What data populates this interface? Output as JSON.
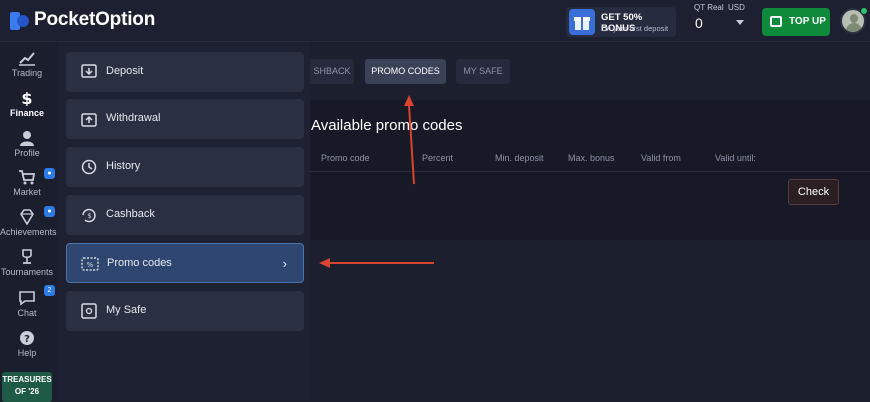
{
  "brand": {
    "name": "PocketOption"
  },
  "header": {
    "bonus_title": "GET 50% BONUS",
    "bonus_sub": "On your first deposit",
    "account_type": "QT Real",
    "currency": "USD",
    "balance": "0",
    "topup_label": "TOP UP"
  },
  "sidebar": {
    "items": [
      {
        "label": "Trading",
        "icon": "chart-icon"
      },
      {
        "label": "Finance",
        "icon": "dollar-icon",
        "active": true
      },
      {
        "label": "Profile",
        "icon": "user-icon"
      },
      {
        "label": "Market",
        "icon": "cart-icon",
        "badge": ""
      },
      {
        "label": "Achievements",
        "icon": "diamond-icon",
        "badge": ""
      },
      {
        "label": "Tournaments",
        "icon": "trophy-icon"
      },
      {
        "label": "Chat",
        "icon": "chat-icon",
        "badge": "2"
      },
      {
        "label": "Help",
        "icon": "help-icon"
      }
    ],
    "promo_tile": {
      "line1": "TREASURES",
      "line2": "OF '26"
    }
  },
  "finance_menu": {
    "items": [
      {
        "label": "Deposit",
        "icon": "deposit-icon"
      },
      {
        "label": "Withdrawal",
        "icon": "withdrawal-icon"
      },
      {
        "label": "History",
        "icon": "history-icon"
      },
      {
        "label": "Cashback",
        "icon": "cashback-icon"
      },
      {
        "label": "Promo codes",
        "icon": "promo-code-icon",
        "selected": true
      },
      {
        "label": "My Safe",
        "icon": "safe-icon"
      }
    ]
  },
  "main": {
    "tabs": [
      {
        "label": "SHBACK"
      },
      {
        "label": "PROMO CODES",
        "active": true
      },
      {
        "label": "MY SAFE"
      }
    ],
    "title": "Available promo codes",
    "columns": [
      "Promo code",
      "Percent",
      "Min. deposit",
      "Max. bonus",
      "Valid from",
      "Valid until:"
    ],
    "check_label": "Check"
  },
  "colors": {
    "accent_green": "#0f8a3b",
    "selected_bg": "#2f4770",
    "arrow_red": "#d9432f"
  }
}
